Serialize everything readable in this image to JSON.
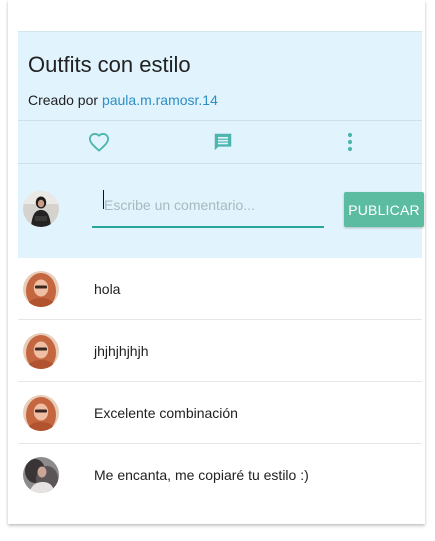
{
  "post": {
    "title": "Outfits con estilo",
    "author_prefix": "Creado por ",
    "author": "paula.m.ramosr.14"
  },
  "actions": {
    "like_icon": "heart-outline-icon",
    "comment_icon": "comment-icon",
    "more_icon": "more-vert-icon",
    "accent_color": "#4db6ac"
  },
  "composer": {
    "placeholder": "Escribe un comentario...",
    "value": "",
    "publish_label": "PUBLICAR"
  },
  "comments": [
    {
      "text": "hola"
    },
    {
      "text": "jhjhjhjhjh"
    },
    {
      "text": "Excelente combinación"
    },
    {
      "text": "Me encanta, me copiaré tu estilo :)"
    }
  ],
  "colors": {
    "panel_background": "#e1f4fd",
    "link": "#2c8ec6",
    "button": "#5cbca1",
    "input_underline": "#26a69a"
  }
}
